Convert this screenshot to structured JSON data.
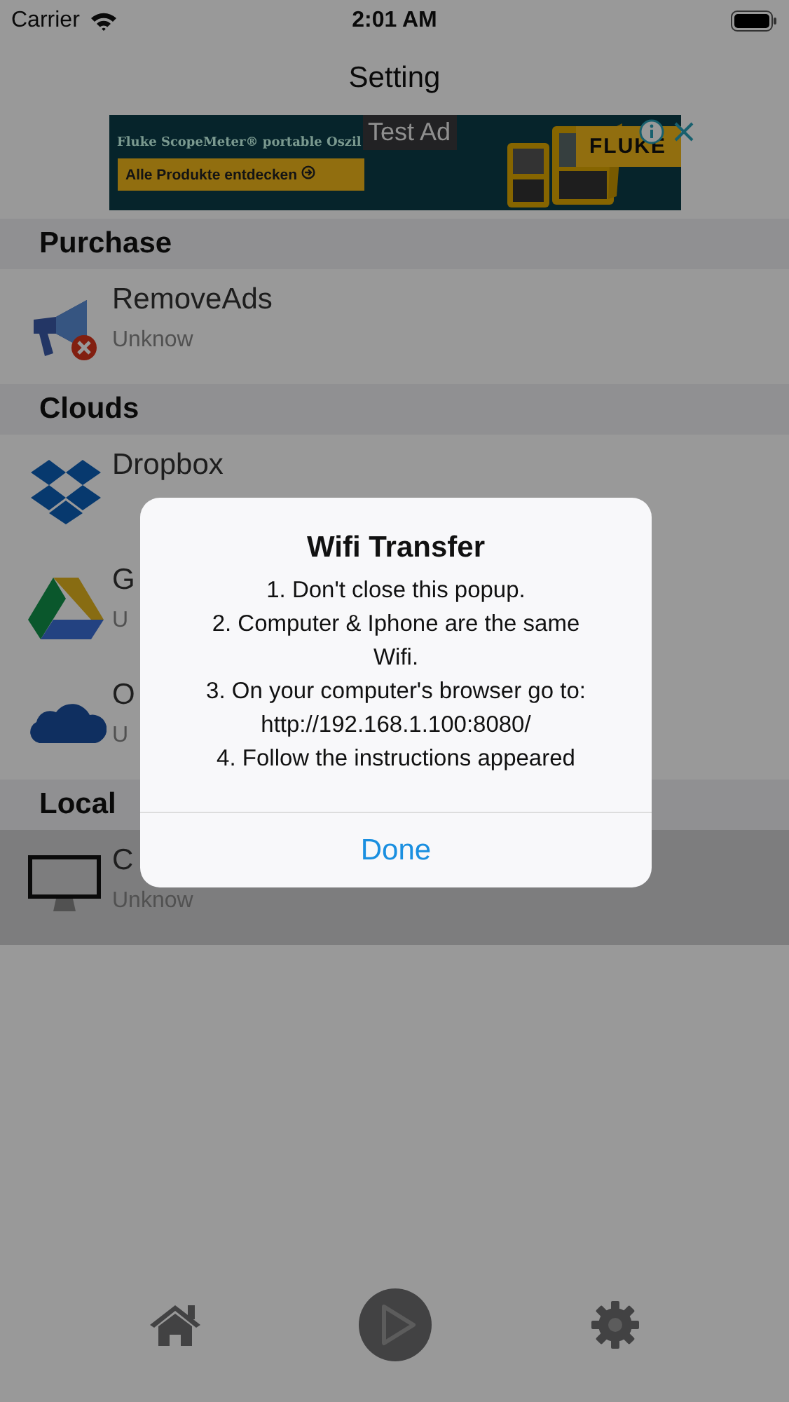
{
  "status_bar": {
    "carrier": "Carrier",
    "time": "2:01 AM"
  },
  "nav": {
    "title": "Setting"
  },
  "ad": {
    "headline": "Fluke ScopeMeter® portable Oszil",
    "button": "Alle Produkte entdecken",
    "brand": "FLUKE",
    "label": "Test Ad"
  },
  "sections": [
    {
      "title": "Purchase",
      "rows": [
        {
          "kind": "megaphone",
          "title": "RemoveAds",
          "subtitle": "Unknow",
          "selected": false
        }
      ]
    },
    {
      "title": "Clouds",
      "rows": [
        {
          "kind": "dropbox",
          "title": "Dropbox",
          "selected": false
        },
        {
          "kind": "drive",
          "title": "G",
          "subtitle": "U",
          "selected": false
        },
        {
          "kind": "cloud",
          "title": "O",
          "subtitle": "U",
          "selected": false
        }
      ]
    },
    {
      "title": "Local",
      "rows": [
        {
          "kind": "monitor",
          "title": "C",
          "subtitle": "Unknow",
          "selected": true
        }
      ]
    }
  ],
  "dialog": {
    "title": "Wifi Transfer",
    "lines": [
      "1. Don't close this popup.",
      "2. Computer & Iphone are the same Wifi.",
      "3. On your computer's browser go to:",
      "http://192.168.1.100:8080/",
      "4. Follow the instructions appeared"
    ],
    "button": "Done"
  }
}
